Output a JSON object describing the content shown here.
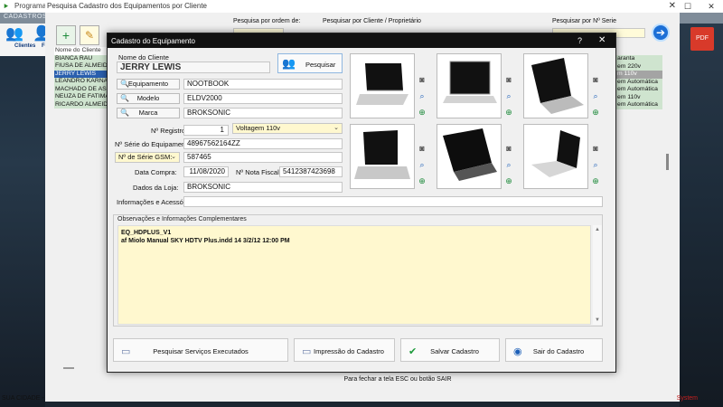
{
  "outer": {
    "title": "Programa C",
    "section": "CADASTROS",
    "toolbar": [
      {
        "label": "Clientes"
      },
      {
        "label": "For"
      }
    ],
    "status_left": "SUA CIDADE -",
    "status_right": "System"
  },
  "back": {
    "title": "Pesquisa Cadastro dos Equipamentos por Cliente",
    "order_label": "Pesquisa por ordem de:",
    "client_label": "Pesquisar por Cliente / Proprietário",
    "serial_label": "Pesquisar por Nº Serie",
    "list_header": "Nome do Cliente",
    "clients": [
      "BIANCA RAU",
      "FIUSA DE ALMEIDA",
      "JERRY LEWIS",
      "LEANDRO KARNAL",
      "MACHADO DE ASS",
      "NEUZA DE FATIMA",
      "RICARDO ALMEIDA"
    ],
    "selected_index": 2,
    "right_rows": [
      "aranta",
      "em 220v",
      "m 110v",
      "em Automática",
      "em Automática",
      "em 110v",
      "em Automática"
    ],
    "close_hint": "Para fechar a tela ESC ou botão SAIR"
  },
  "dialog": {
    "title": "Cadastro do Equipamento",
    "help": "?",
    "close": "✕",
    "client_label": "Nome do Cliente",
    "client_value": "JERRY LEWIS",
    "search_button": "Pesquisar",
    "equipamento_label": "Equipamento",
    "equipamento_value": "NOOTBOOK",
    "modelo_label": "Modelo",
    "modelo_value": "ELDV2000",
    "marca_label": "Marca",
    "marca_value": "BROKSONIC",
    "registro_label": "Nº Registro:",
    "registro_value": "1",
    "voltagem_value": "Voltagem 110v",
    "serie_label": "Nº Série do Equipamento:",
    "serie_value": "48967562164ZZ",
    "gsm_label": "Nº de Série GSM:",
    "gsm_value": "587465",
    "compra_label": "Data Compra:",
    "compra_value": "11/08/2020",
    "nf_label": "Nº  Nota Fiscal:",
    "nf_value": "5412387423698",
    "loja_label": "Dados da Loja:",
    "loja_value": "BROKSONIC",
    "info_label": "Informações e Acessórios:",
    "info_value": "",
    "obs_label": "Observações e Informações Complementares",
    "obs_text": "EQ_HDPLUS_V1\naf Miolo Manual SKY HDTV Plus.indd 14 3/2/12 12:00 PM",
    "buttons": {
      "servicos": "Pesquisar Serviços Executados",
      "impressao": "Impressão do Cadastro",
      "salvar": "Salvar Cadastro",
      "sair": "Sair do Cadastro"
    }
  }
}
